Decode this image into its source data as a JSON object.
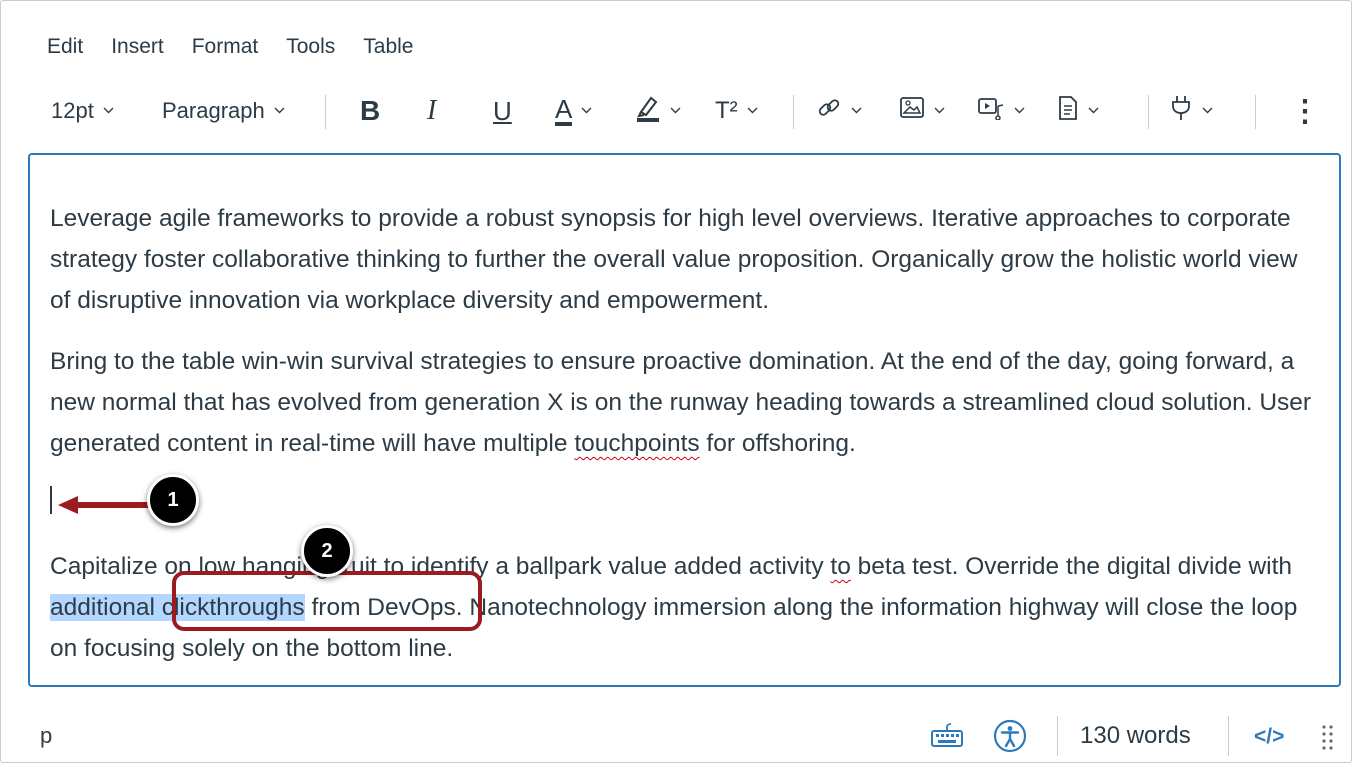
{
  "menubar": {
    "items": [
      "Edit",
      "Insert",
      "Format",
      "Tools",
      "Table"
    ]
  },
  "toolbar": {
    "font_size": "12pt",
    "block_format": "Paragraph",
    "bold": "B",
    "italic": "I",
    "underline": "U",
    "text_color": "A",
    "superscript": "T²",
    "more": "⋮",
    "icons": [
      "bold-icon",
      "italic-icon",
      "underline-icon",
      "text-color-icon",
      "highlight-icon",
      "superscript-icon",
      "link-icon",
      "image-icon",
      "media-icon",
      "document-icon",
      "apps-plug-icon",
      "more-icon"
    ]
  },
  "editor": {
    "paragraph1": "Leverage agile frameworks to provide a robust synopsis for high level overviews. Iterative approaches to corporate strategy foster collaborative thinking to further the overall value proposition. Organically grow the holistic world view of disruptive innovation via workplace diversity and empowerment.",
    "paragraph2_before": "Bring to the table win-win survival strategies to ensure proactive domination. At the end of the day, going forward, a new normal that has evolved from generation X is on the runway heading towards a streamlined cloud solution. User generated content in real-time will have multiple ",
    "paragraph2_spell": "touchpoints",
    "paragraph2_after": " for offshoring.",
    "paragraph4_a": "Capitalize on low hanging fruit to identify a ballpark value added activity ",
    "paragraph4_spell": "to",
    "paragraph4_b": " beta test. Override the digital divide with ",
    "paragraph4_selected": "additional clickthroughs",
    "paragraph4_c": " from DevOps. Nanotechnology immersion along the information highway will close the loop on focusing solely on the bottom line."
  },
  "callouts": {
    "one": "1",
    "two": "2"
  },
  "statusbar": {
    "element_path": "p",
    "word_count": "130 words",
    "html_toggle": "</>",
    "icons": [
      "keyboard-icon",
      "accessibility-icon",
      "resize-grip-icon"
    ]
  },
  "colors": {
    "accent": "#2b7abc",
    "callout_red": "#9b1b21",
    "selection": "#b4d7ff",
    "text": "#2d3b45"
  }
}
